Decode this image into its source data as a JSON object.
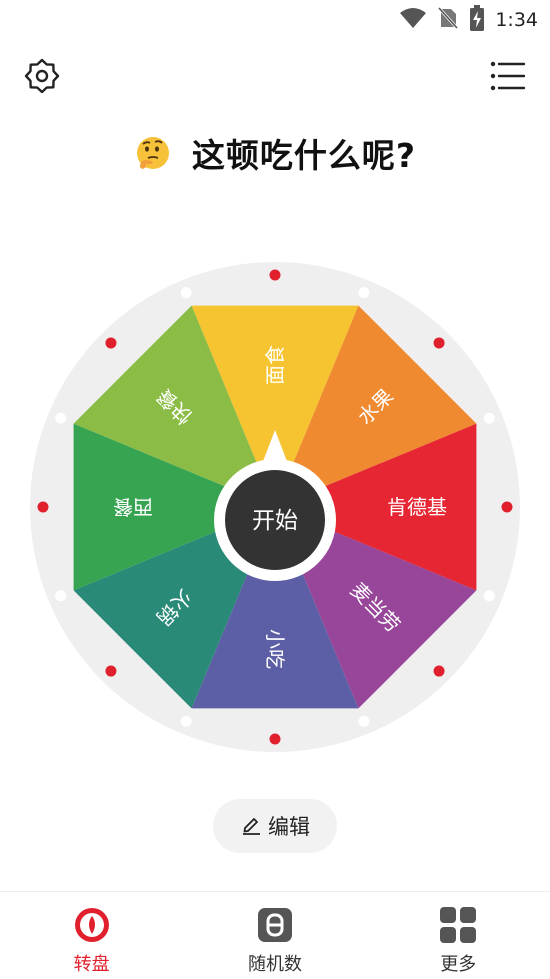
{
  "status": {
    "time": "1:34"
  },
  "header": {
    "title": "这顿吃什么呢?"
  },
  "wheel": {
    "segments": [
      {
        "label": "面食",
        "color": "#f5c430"
      },
      {
        "label": "水果",
        "color": "#f08a30"
      },
      {
        "label": "肯德基",
        "color": "#e62632"
      },
      {
        "label": "麦当劳",
        "color": "#97469a"
      },
      {
        "label": "小吃",
        "color": "#5d5fa6"
      },
      {
        "label": "火锅",
        "color": "#2a8a78"
      },
      {
        "label": "西餐",
        "color": "#37a452"
      },
      {
        "label": "快餐",
        "color": "#8bbd46"
      }
    ],
    "start_label": "开始",
    "hub_color": "#333333",
    "rim_color": "#efefef",
    "dot_red": "#e0202c",
    "dot_white": "#ffffff"
  },
  "edit": {
    "label": "编辑"
  },
  "nav": {
    "items": [
      {
        "label": "转盘",
        "icon": "wheel-icon",
        "active": true
      },
      {
        "label": "随机数",
        "icon": "dice-number-icon",
        "active": false
      },
      {
        "label": "更多",
        "icon": "grid-icon",
        "active": false
      }
    ],
    "accent": "#e0202c"
  }
}
